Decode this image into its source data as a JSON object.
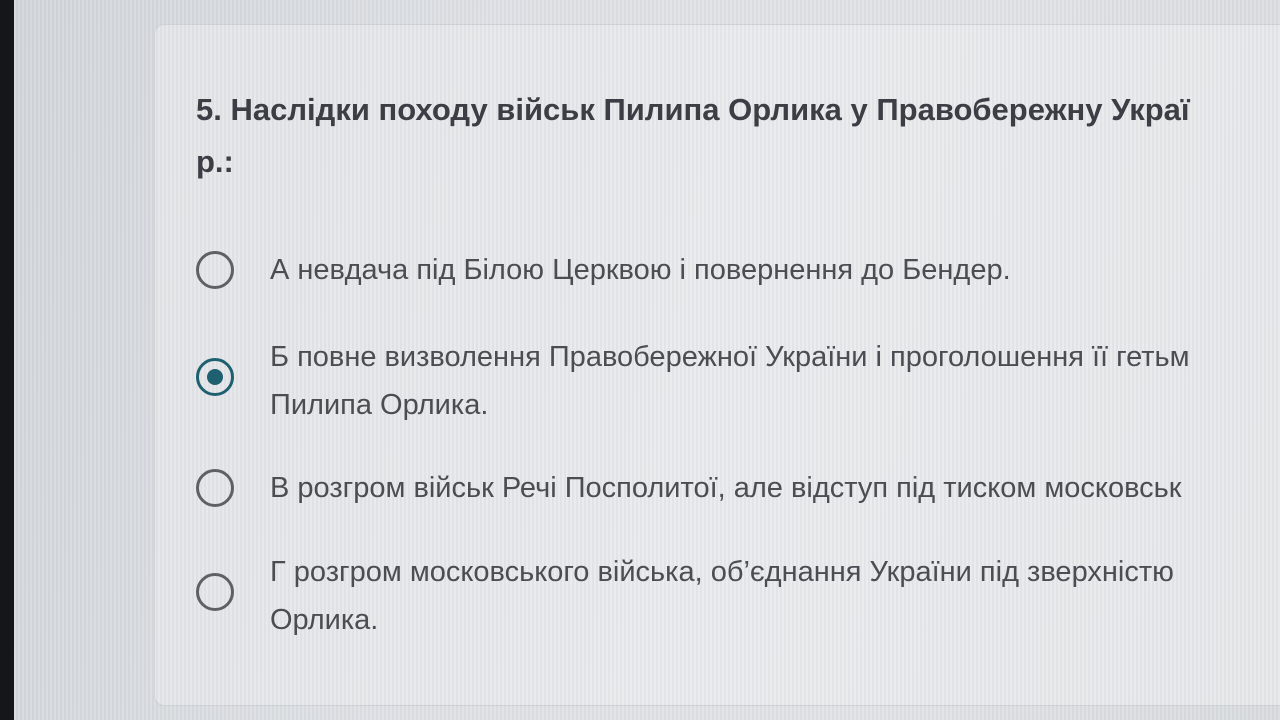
{
  "question": {
    "line1": "5. Наслідки походу військ Пилипа Орлика у Правобережну Украї",
    "line2": "р.:"
  },
  "options": [
    {
      "line1": "А невдача під Білою Церквою і повернення до Бендер.",
      "line2": "",
      "selected": false
    },
    {
      "line1": "Б повне визволення Правобережної України і проголошення її гетьм",
      "line2": "Пилипа Орлика.",
      "selected": true
    },
    {
      "line1": "В розгром військ Речі Посполитої, але відступ під тиском московськ",
      "line2": "",
      "selected": false
    },
    {
      "line1": "Г розгром московського війська, об’єднання України під зверхністю",
      "line2": "Орлика.",
      "selected": false
    }
  ],
  "colors": {
    "radio_selected": "#1f6070",
    "radio_unselected": "#5d6166",
    "text": "#4a4d52"
  }
}
